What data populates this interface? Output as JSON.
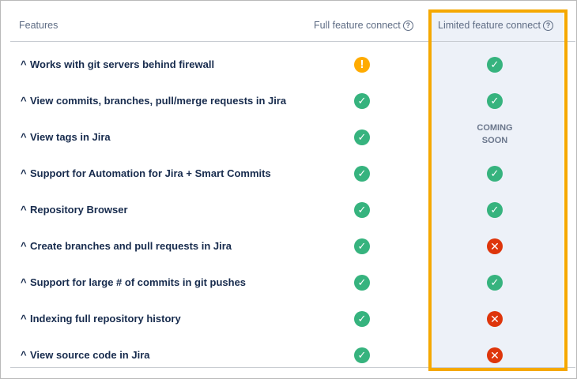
{
  "header": {
    "features": "Features",
    "full": "Full feature connect",
    "limited": "Limited feature connect",
    "help_glyph": "?"
  },
  "rows": [
    {
      "label": "Works with git servers behind firewall",
      "full": "warning",
      "limited": "check"
    },
    {
      "label": "View commits, branches, pull/merge requests in Jira",
      "full": "check",
      "limited": "check"
    },
    {
      "label": "View tags in Jira",
      "full": "check",
      "limited": "coming-soon",
      "coming_soon": [
        "COMING",
        "SOON"
      ]
    },
    {
      "label": "Support for Automation for Jira + Smart Commits",
      "full": "check",
      "limited": "check"
    },
    {
      "label": "Repository Browser",
      "full": "check",
      "limited": "check"
    },
    {
      "label": "Create branches and pull requests in Jira",
      "full": "check",
      "limited": "cross"
    },
    {
      "label": "Support for large # of commits in git pushes",
      "full": "check",
      "limited": "check"
    },
    {
      "label": "Indexing full repository history",
      "full": "check",
      "limited": "cross"
    },
    {
      "label": "View source code in Jira",
      "full": "check",
      "limited": "cross"
    }
  ],
  "colors": {
    "check": "#36b37e",
    "cross": "#de350b",
    "warning": "#ffab00",
    "highlight": "#f5a800"
  }
}
